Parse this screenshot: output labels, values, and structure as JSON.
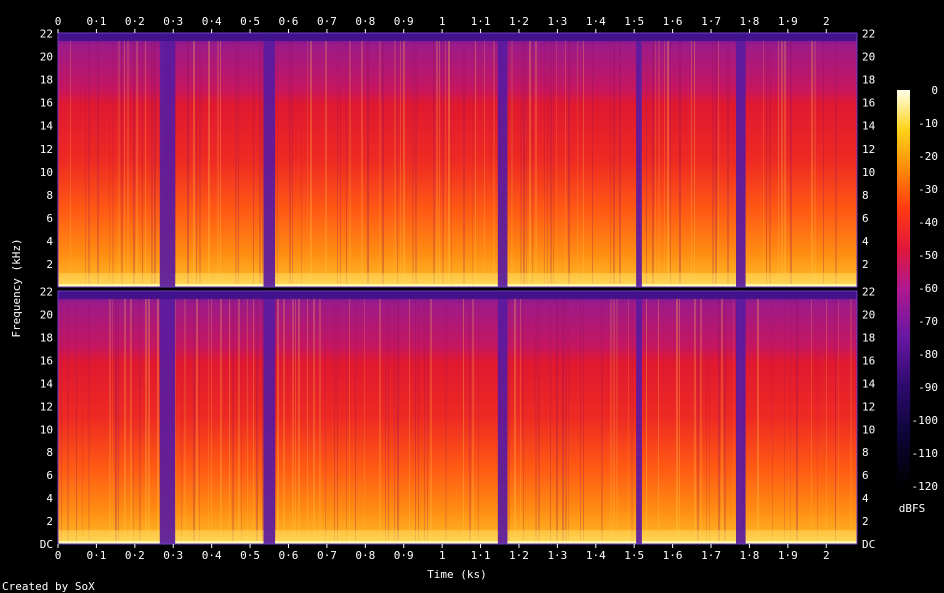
{
  "chart_data": {
    "type": "heatmap",
    "title": "",
    "xlabel": "Time (ks)",
    "ylabel": "Frequency (kHz)",
    "colorbar_label": "dBFS",
    "xlim": [
      0,
      2.08
    ],
    "ylim": [
      0,
      22.05
    ],
    "x_ticks": [
      "0",
      "0·1",
      "0·2",
      "0·3",
      "0·4",
      "0·5",
      "0·6",
      "0·7",
      "0·8",
      "0·9",
      "1",
      "1·1",
      "1·2",
      "1·3",
      "1·4",
      "1·5",
      "1·6",
      "1·7",
      "1·8",
      "1·9",
      "2"
    ],
    "y_ticks_top": [
      "2",
      "4",
      "6",
      "8",
      "10",
      "12",
      "14",
      "16",
      "18",
      "20",
      "22"
    ],
    "y_ticks_bottom": [
      "DC",
      "2",
      "4",
      "6",
      "8",
      "10",
      "12",
      "14",
      "16",
      "18",
      "20",
      "22"
    ],
    "colorbar_ticks": [
      "0",
      "-10",
      "-20",
      "-30",
      "-40",
      "-50",
      "-60",
      "-70",
      "-80",
      "-90",
      "-100",
      "-110",
      "-120"
    ],
    "colorbar_range": [
      -120,
      0
    ],
    "channels": 2,
    "quiet_segments_ks": [
      [
        0.265,
        0.305
      ],
      [
        0.535,
        0.565
      ],
      [
        1.145,
        1.17
      ],
      [
        1.505,
        1.52
      ],
      [
        1.765,
        1.79
      ]
    ]
  },
  "footer": {
    "credit": "Created by SoX"
  },
  "colors": {
    "background": "#000000",
    "text": "#ffffff",
    "plot_border": "#6a3cc8"
  }
}
